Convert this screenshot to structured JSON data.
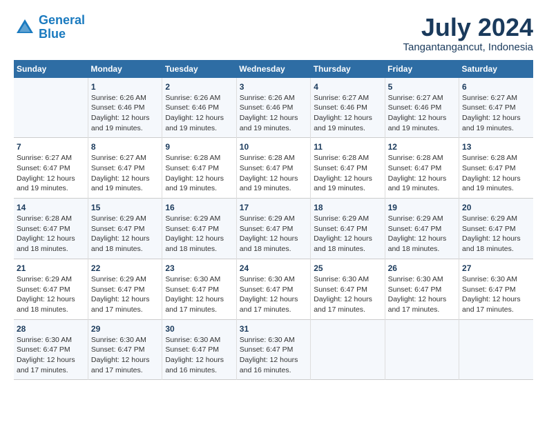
{
  "logo": {
    "line1": "General",
    "line2": "Blue"
  },
  "title": "July 2024",
  "location": "Tangantangancut, Indonesia",
  "days_header": [
    "Sunday",
    "Monday",
    "Tuesday",
    "Wednesday",
    "Thursday",
    "Friday",
    "Saturday"
  ],
  "weeks": [
    [
      {
        "num": "",
        "info": ""
      },
      {
        "num": "1",
        "info": "Sunrise: 6:26 AM\nSunset: 6:46 PM\nDaylight: 12 hours\nand 19 minutes."
      },
      {
        "num": "2",
        "info": "Sunrise: 6:26 AM\nSunset: 6:46 PM\nDaylight: 12 hours\nand 19 minutes."
      },
      {
        "num": "3",
        "info": "Sunrise: 6:26 AM\nSunset: 6:46 PM\nDaylight: 12 hours\nand 19 minutes."
      },
      {
        "num": "4",
        "info": "Sunrise: 6:27 AM\nSunset: 6:46 PM\nDaylight: 12 hours\nand 19 minutes."
      },
      {
        "num": "5",
        "info": "Sunrise: 6:27 AM\nSunset: 6:46 PM\nDaylight: 12 hours\nand 19 minutes."
      },
      {
        "num": "6",
        "info": "Sunrise: 6:27 AM\nSunset: 6:47 PM\nDaylight: 12 hours\nand 19 minutes."
      }
    ],
    [
      {
        "num": "7",
        "info": "Sunrise: 6:27 AM\nSunset: 6:47 PM\nDaylight: 12 hours\nand 19 minutes."
      },
      {
        "num": "8",
        "info": "Sunrise: 6:27 AM\nSunset: 6:47 PM\nDaylight: 12 hours\nand 19 minutes."
      },
      {
        "num": "9",
        "info": "Sunrise: 6:28 AM\nSunset: 6:47 PM\nDaylight: 12 hours\nand 19 minutes."
      },
      {
        "num": "10",
        "info": "Sunrise: 6:28 AM\nSunset: 6:47 PM\nDaylight: 12 hours\nand 19 minutes."
      },
      {
        "num": "11",
        "info": "Sunrise: 6:28 AM\nSunset: 6:47 PM\nDaylight: 12 hours\nand 19 minutes."
      },
      {
        "num": "12",
        "info": "Sunrise: 6:28 AM\nSunset: 6:47 PM\nDaylight: 12 hours\nand 19 minutes."
      },
      {
        "num": "13",
        "info": "Sunrise: 6:28 AM\nSunset: 6:47 PM\nDaylight: 12 hours\nand 19 minutes."
      }
    ],
    [
      {
        "num": "14",
        "info": "Sunrise: 6:28 AM\nSunset: 6:47 PM\nDaylight: 12 hours\nand 18 minutes."
      },
      {
        "num": "15",
        "info": "Sunrise: 6:29 AM\nSunset: 6:47 PM\nDaylight: 12 hours\nand 18 minutes."
      },
      {
        "num": "16",
        "info": "Sunrise: 6:29 AM\nSunset: 6:47 PM\nDaylight: 12 hours\nand 18 minutes."
      },
      {
        "num": "17",
        "info": "Sunrise: 6:29 AM\nSunset: 6:47 PM\nDaylight: 12 hours\nand 18 minutes."
      },
      {
        "num": "18",
        "info": "Sunrise: 6:29 AM\nSunset: 6:47 PM\nDaylight: 12 hours\nand 18 minutes."
      },
      {
        "num": "19",
        "info": "Sunrise: 6:29 AM\nSunset: 6:47 PM\nDaylight: 12 hours\nand 18 minutes."
      },
      {
        "num": "20",
        "info": "Sunrise: 6:29 AM\nSunset: 6:47 PM\nDaylight: 12 hours\nand 18 minutes."
      }
    ],
    [
      {
        "num": "21",
        "info": "Sunrise: 6:29 AM\nSunset: 6:47 PM\nDaylight: 12 hours\nand 18 minutes."
      },
      {
        "num": "22",
        "info": "Sunrise: 6:29 AM\nSunset: 6:47 PM\nDaylight: 12 hours\nand 17 minutes."
      },
      {
        "num": "23",
        "info": "Sunrise: 6:30 AM\nSunset: 6:47 PM\nDaylight: 12 hours\nand 17 minutes."
      },
      {
        "num": "24",
        "info": "Sunrise: 6:30 AM\nSunset: 6:47 PM\nDaylight: 12 hours\nand 17 minutes."
      },
      {
        "num": "25",
        "info": "Sunrise: 6:30 AM\nSunset: 6:47 PM\nDaylight: 12 hours\nand 17 minutes."
      },
      {
        "num": "26",
        "info": "Sunrise: 6:30 AM\nSunset: 6:47 PM\nDaylight: 12 hours\nand 17 minutes."
      },
      {
        "num": "27",
        "info": "Sunrise: 6:30 AM\nSunset: 6:47 PM\nDaylight: 12 hours\nand 17 minutes."
      }
    ],
    [
      {
        "num": "28",
        "info": "Sunrise: 6:30 AM\nSunset: 6:47 PM\nDaylight: 12 hours\nand 17 minutes."
      },
      {
        "num": "29",
        "info": "Sunrise: 6:30 AM\nSunset: 6:47 PM\nDaylight: 12 hours\nand 17 minutes."
      },
      {
        "num": "30",
        "info": "Sunrise: 6:30 AM\nSunset: 6:47 PM\nDaylight: 12 hours\nand 16 minutes."
      },
      {
        "num": "31",
        "info": "Sunrise: 6:30 AM\nSunset: 6:47 PM\nDaylight: 12 hours\nand 16 minutes."
      },
      {
        "num": "",
        "info": ""
      },
      {
        "num": "",
        "info": ""
      },
      {
        "num": "",
        "info": ""
      }
    ]
  ]
}
